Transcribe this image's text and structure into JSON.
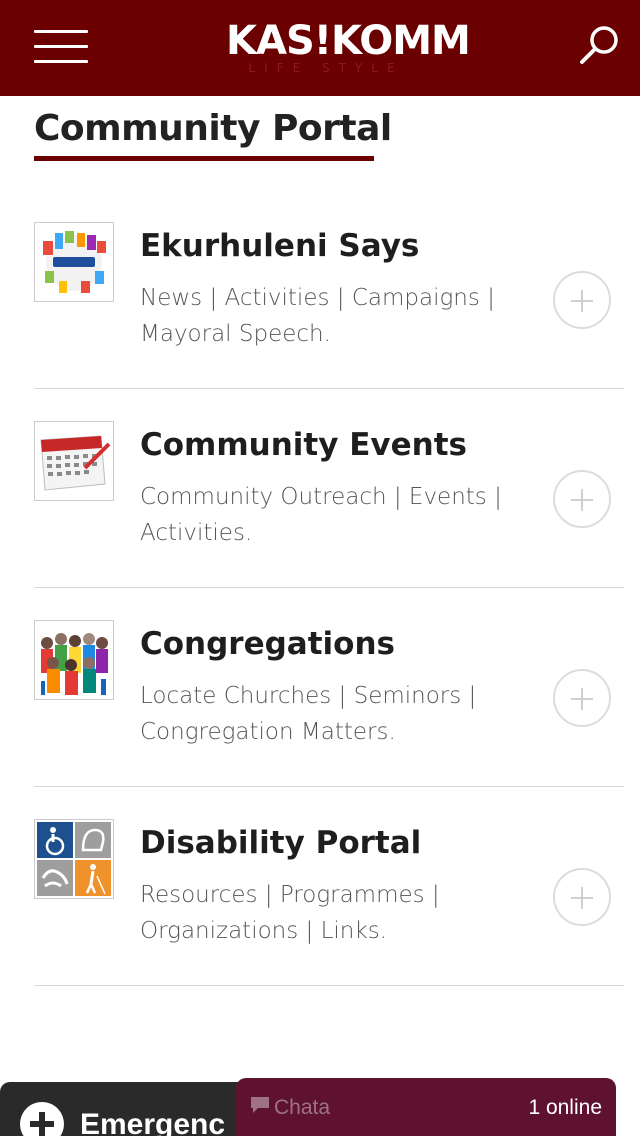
{
  "header": {
    "logo_main": "KAS!KOMM",
    "logo_sub": "LIFE STYLE",
    "bg_color": "#6b0000"
  },
  "page": {
    "title": "Community Portal"
  },
  "items": [
    {
      "title": "Ekurhuleni Says",
      "description": "News | Activities | Campaigns | Mayoral Speech.",
      "icon": "ekurhuleni-logo-icon"
    },
    {
      "title": "Community Events",
      "description": "Community Outreach | Events | Activities.",
      "icon": "calendar-icon"
    },
    {
      "title": "Congregations",
      "description": "Locate Churches | Seminors | Congregation Matters.",
      "icon": "crowd-icon"
    },
    {
      "title": "Disability Portal",
      "description": "Resources | Programmes | Organizations | Links.",
      "icon": "accessibility-icon"
    }
  ],
  "emergency": {
    "label": "Emergenc"
  },
  "chat": {
    "label": "Chata",
    "online": "1 online"
  }
}
